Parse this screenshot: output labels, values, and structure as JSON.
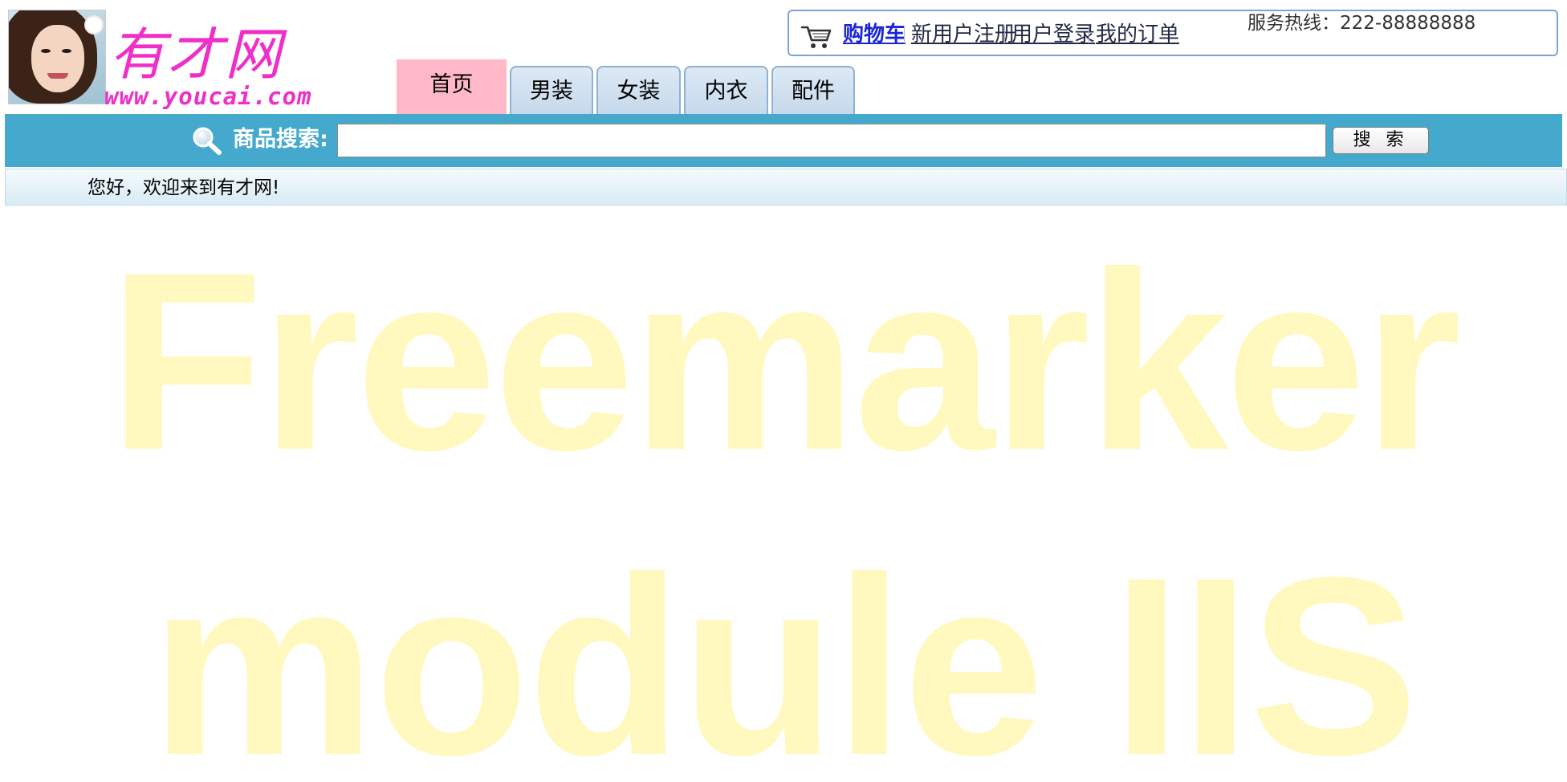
{
  "logo": {
    "title": "有才网",
    "url": "www.youcai.com",
    "photo_icon": "portrait-photo",
    "brand_color": "#ee2fc8"
  },
  "top_links": {
    "cart_icon": "shopping-cart-icon",
    "cart": "购物车",
    "register": "新用户注册",
    "login": "用户登录",
    "orders": "我的订单",
    "hotline": "服务热线：222-88888888"
  },
  "nav": {
    "tabs": [
      {
        "label": "首页",
        "active": true
      },
      {
        "label": "男装",
        "active": false
      },
      {
        "label": "女装",
        "active": false
      },
      {
        "label": "内衣",
        "active": false
      },
      {
        "label": "配件",
        "active": false
      }
    ],
    "active_color": "#ffb8c8"
  },
  "search": {
    "icon": "magnifier-icon",
    "label": "商品搜索:",
    "value": "",
    "button": "搜 索",
    "bar_color": "#44a9cd"
  },
  "welcome": {
    "text": "您好，欢迎来到有才网!"
  },
  "watermark": {
    "line1": "Freemarker",
    "line2": "module IIS",
    "color": "#fff9c0"
  }
}
